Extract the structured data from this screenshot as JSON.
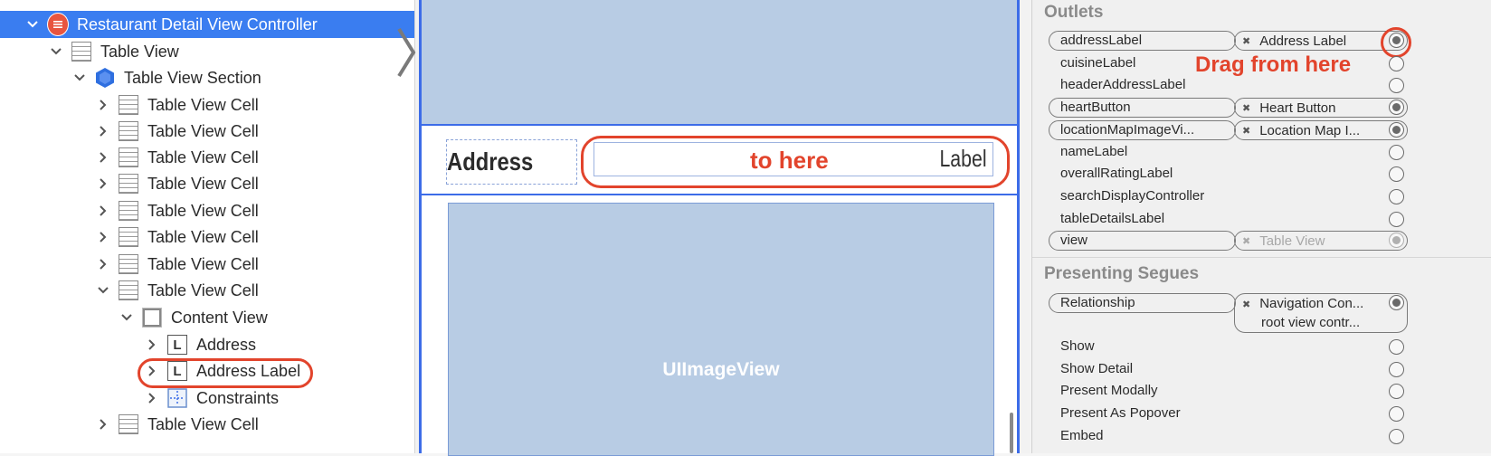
{
  "outline": {
    "items": [
      {
        "label": "Restaurant Detail View Controller",
        "icon": "view-controller-icon",
        "selected": true
      },
      {
        "label": "Table View",
        "icon": "table-view-icon"
      },
      {
        "label": "Table View Section",
        "icon": "table-section-icon"
      },
      {
        "label": "Table View Cell",
        "icon": "table-cell-icon"
      },
      {
        "label": "Table View Cell",
        "icon": "table-cell-icon"
      },
      {
        "label": "Table View Cell",
        "icon": "table-cell-icon"
      },
      {
        "label": "Table View Cell",
        "icon": "table-cell-icon"
      },
      {
        "label": "Table View Cell",
        "icon": "table-cell-icon"
      },
      {
        "label": "Table View Cell",
        "icon": "table-cell-icon"
      },
      {
        "label": "Table View Cell",
        "icon": "table-cell-icon"
      },
      {
        "label": "Table View Cell",
        "icon": "table-cell-icon"
      },
      {
        "label": "Content View",
        "icon": "content-view-icon"
      },
      {
        "label": "Address",
        "icon": "label-icon"
      },
      {
        "label": "Address Label",
        "icon": "label-icon"
      },
      {
        "label": "Constraints",
        "icon": "constraints-icon"
      },
      {
        "label": "Table View Cell",
        "icon": "table-cell-icon"
      }
    ]
  },
  "canvas": {
    "address_title": "Address",
    "address_value": "Label",
    "annotation_to_here": "to here",
    "image_view_label": "UIImageView"
  },
  "inspector": {
    "outlets_title": "Outlets",
    "drag_annotation": "Drag from here",
    "outlets": [
      {
        "name": "addressLabel",
        "connection": "Address Label",
        "connected": true
      },
      {
        "name": "cuisineLabel",
        "connection": "",
        "connected": false
      },
      {
        "name": "headerAddressLabel",
        "connection": "",
        "connected": false
      },
      {
        "name": "heartButton",
        "connection": "Heart Button",
        "connected": true
      },
      {
        "name": "locationMapImageVi...",
        "connection": "Location Map I...",
        "connected": true
      },
      {
        "name": "nameLabel",
        "connection": "",
        "connected": false
      },
      {
        "name": "overallRatingLabel",
        "connection": "",
        "connected": false
      },
      {
        "name": "searchDisplayController",
        "connection": "",
        "connected": false
      },
      {
        "name": "tableDetailsLabel",
        "connection": "",
        "connected": false
      },
      {
        "name": "view",
        "connection": "Table View",
        "connected": true
      }
    ],
    "segues_title": "Presenting Segues",
    "relationship": {
      "name": "Relationship",
      "line1": "Navigation Con...",
      "line2": "root view contr..."
    },
    "segues": [
      "Show",
      "Show Detail",
      "Present Modally",
      "Present As Popover",
      "Embed"
    ]
  },
  "colors": {
    "selection": "#3a7df0",
    "annotation": "#e2442c",
    "placeholder_blue": "#b8cce4",
    "scene_border": "#3c6ce8"
  }
}
